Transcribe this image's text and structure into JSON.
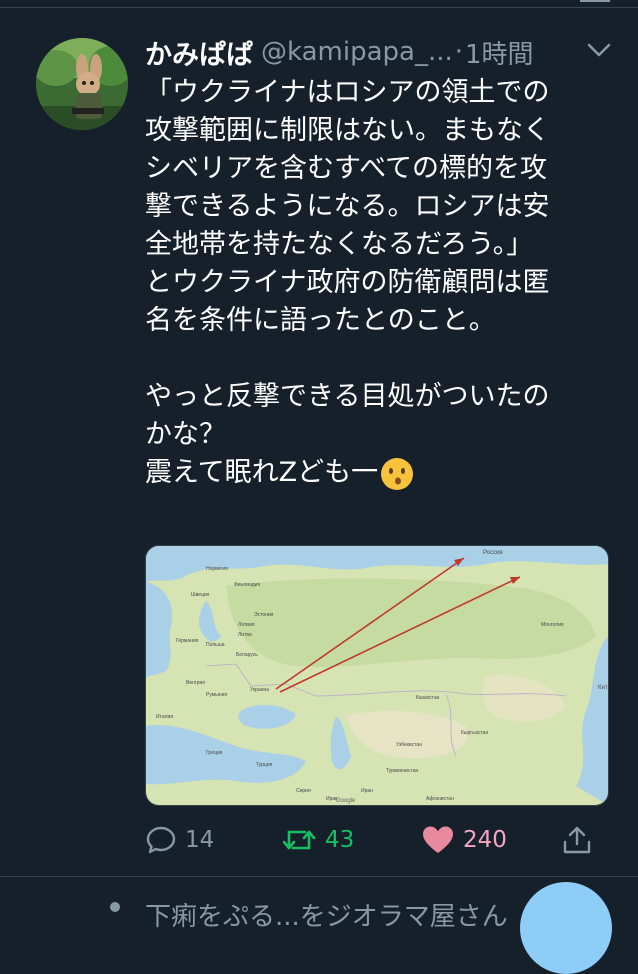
{
  "tweet": {
    "display_name": "かみぱぱ",
    "handle": "@kamipapa_...",
    "separator": "·",
    "time": "1時間",
    "text_lines": [
      "「ウクライナはロシアの領土での",
      "攻撃範囲に制限はない。まもなく",
      "シベリアを含むすべての標的を攻",
      "撃できるようになる。ロシアは安",
      "全地帯を持たなくなるだろう。」",
      "とウクライナ政府の防衛顧問は匿",
      "名を条件に語ったとのこと。",
      "",
      "やっと反撃できる目処がついたの",
      "かな？",
      "震えて眠れZども一"
    ],
    "emoji_name": "kissing-face-emoji",
    "stats": {
      "replies": "14",
      "retweets": "43",
      "likes": "240"
    }
  },
  "map": {
    "labels": {
      "russia": "Россия",
      "ukraine": "Украина",
      "kazakhstan": "Казахстан",
      "mongolia": "Монголия",
      "poland": "Польша",
      "germany": "Германия",
      "turkey": "Турция",
      "iran": "Иран",
      "afghanistan": "Афганистан",
      "norway": "Норвегия",
      "finland": "Финляндия",
      "sweden": "Швеция",
      "belarus": "Беларусь",
      "kyrgyzstan": "Кыргызстан",
      "uzbekistan": "Узбекистан",
      "turkmenistan": "Туркменистан",
      "estonia": "Эстония",
      "latvia": "Латвия",
      "lithuania": "Литва",
      "romania": "Румыния",
      "hungary": "Венгрия",
      "italy": "Италия",
      "greece": "Греция",
      "syria": "Сирия",
      "iraq": "Ирак",
      "google": "Google",
      "edge_kit": "Кит"
    },
    "colors": {
      "water": "#a9d0e6",
      "land": "#d6e3b3",
      "forest": "#bfd79a",
      "desert": "#eae3c9",
      "arrow": "#c0392b"
    }
  },
  "next": {
    "text": "下痢をぷる...をジオラマ屋さん"
  }
}
